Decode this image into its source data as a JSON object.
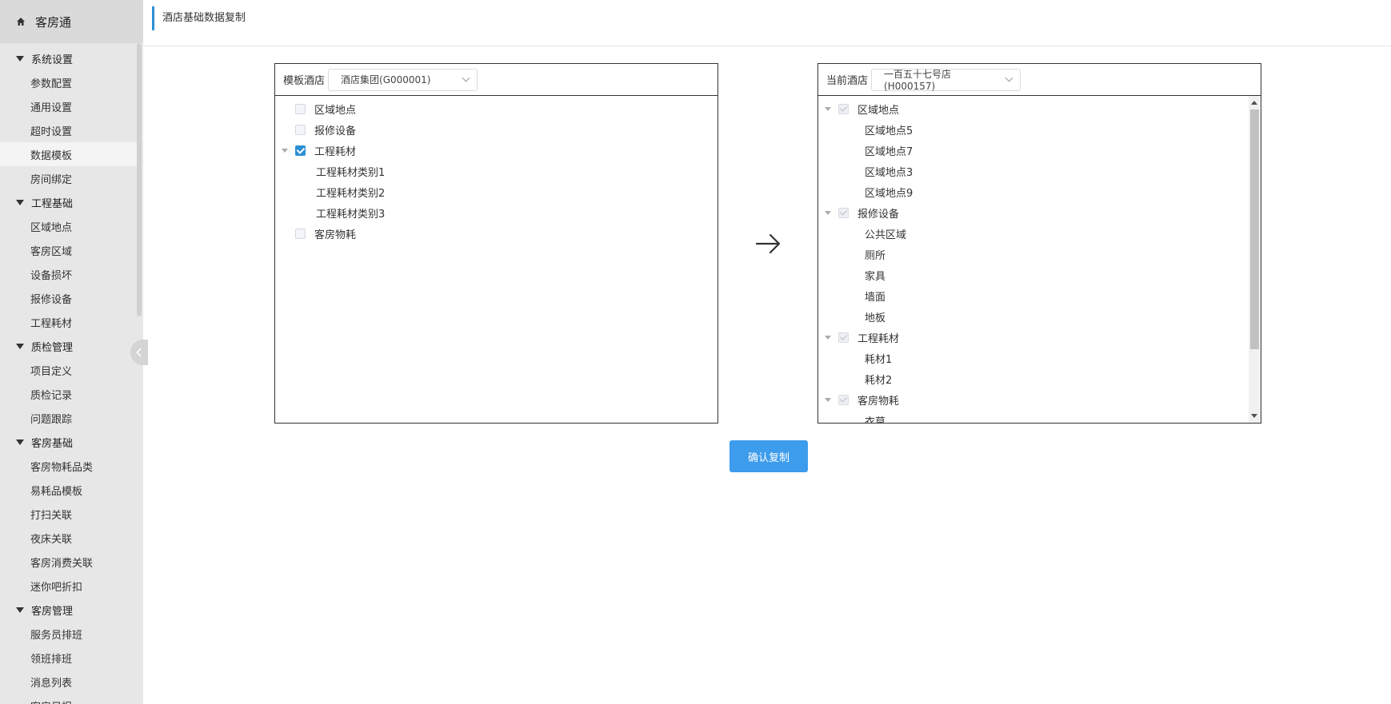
{
  "app": {
    "brand": "客房通"
  },
  "sidebar": {
    "groups": [
      {
        "label": "系统设置",
        "items": [
          "参数配置",
          "通用设置",
          "超时设置",
          "数据模板",
          "房间绑定"
        ]
      },
      {
        "label": "工程基础",
        "items": [
          "区域地点",
          "客房区域",
          "设备损坏",
          "报修设备",
          "工程耗材"
        ]
      },
      {
        "label": "质检管理",
        "items": [
          "项目定义",
          "质检记录",
          "问题跟踪"
        ]
      },
      {
        "label": "客房基础",
        "items": [
          "客房物耗品类",
          "易耗品模板",
          "打扫关联",
          "夜床关联",
          "客房消费关联",
          "迷你吧折扣"
        ]
      },
      {
        "label": "客房管理",
        "items": [
          "服务员排班",
          "领班排班",
          "消息列表",
          "客房日报"
        ]
      }
    ],
    "active_item": "数据模板"
  },
  "page": {
    "title": "酒店基础数据复制"
  },
  "left_panel": {
    "label": "模板酒店",
    "select_value": "酒店集团(G000001)",
    "tree": [
      {
        "label": "区域地点",
        "checked": false,
        "expanded": false,
        "children": []
      },
      {
        "label": "报修设备",
        "checked": false,
        "expanded": false,
        "children": []
      },
      {
        "label": "工程耗材",
        "checked": true,
        "expanded": true,
        "children": [
          "工程耗材类别1",
          "工程耗材类别2",
          "工程耗材类别3"
        ]
      },
      {
        "label": "客房物耗",
        "checked": false,
        "expanded": false,
        "children": []
      }
    ]
  },
  "right_panel": {
    "label": "当前酒店",
    "select_value": "一百五十七号店(H000157)",
    "tree": [
      {
        "label": "区域地点",
        "children": [
          "区域地点5",
          "区域地点7",
          "区域地点3",
          "区域地点9"
        ]
      },
      {
        "label": "报修设备",
        "children": [
          "公共区域",
          "厕所",
          "家具",
          "墙面",
          "地板"
        ]
      },
      {
        "label": "工程耗材",
        "children": [
          "耗材1",
          "耗材2"
        ]
      },
      {
        "label": "客房物耗",
        "children": [
          "衣草"
        ]
      }
    ]
  },
  "actions": {
    "confirm_label": "确认复制"
  },
  "colors": {
    "accent": "#3d9cec",
    "title_bar": "#2d8fd5",
    "sidebar_bg": "#e6e7e6"
  }
}
